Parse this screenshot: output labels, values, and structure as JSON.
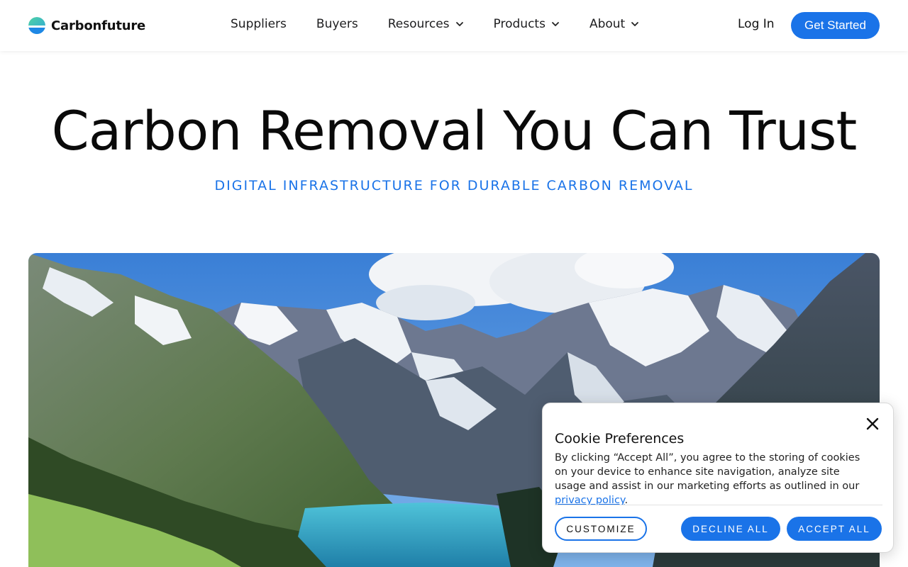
{
  "header": {
    "brand": "Carbonfuture",
    "nav": [
      {
        "label": "Suppliers",
        "has_dropdown": false
      },
      {
        "label": "Buyers",
        "has_dropdown": false
      },
      {
        "label": "Resources",
        "has_dropdown": true
      },
      {
        "label": "Products",
        "has_dropdown": true
      },
      {
        "label": "About",
        "has_dropdown": true
      }
    ],
    "login_label": "Log In",
    "cta_label": "Get Started"
  },
  "hero": {
    "title": "Carbon Removal You Can Trust",
    "subtitle": "DIGITAL INFRASTRUCTURE FOR DURABLE CARBON REMOVAL"
  },
  "cookie": {
    "title": "Cookie Preferences",
    "body": "By clicking “Accept All”, you agree to the storing of cookies on your device to enhance site navigation, analyze site usage and assist in our marketing efforts as outlined in our ",
    "link_label": "privacy policy",
    "body_end": ".",
    "customize_label": "CUSTOMIZE",
    "decline_label": "DECLINE ALL",
    "accept_label": "ACCEPT ALL"
  },
  "colors": {
    "accent": "#1a73e8",
    "text": "#111111"
  },
  "icons": {
    "logo": "carbonfuture-logo-icon",
    "dropdown": "chevron-down-icon",
    "close": "close-icon"
  }
}
